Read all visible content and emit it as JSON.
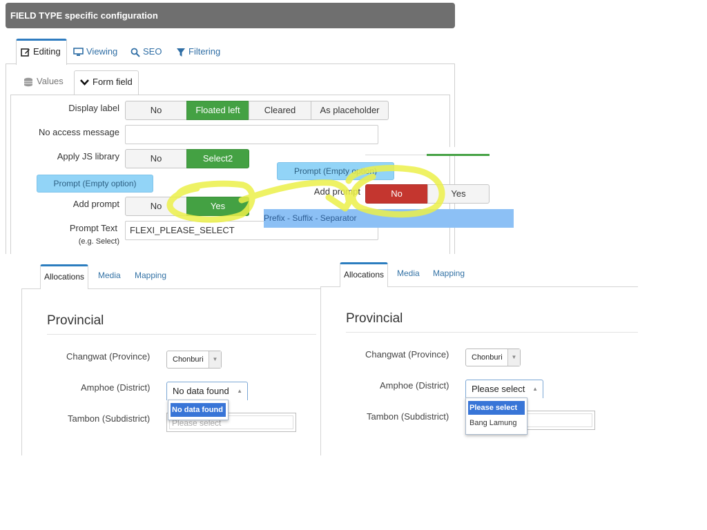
{
  "header": {
    "title": "FIELD TYPE specific configuration"
  },
  "top_tabs": [
    {
      "label": "Editing",
      "icon": "edit-icon",
      "active": true
    },
    {
      "label": "Viewing",
      "icon": "monitor-icon",
      "active": false
    },
    {
      "label": "SEO",
      "icon": "search-icon",
      "active": false
    },
    {
      "label": "Filtering",
      "icon": "filter-icon",
      "active": false
    }
  ],
  "sub_tabs": [
    {
      "label": "Values",
      "icon": "database-icon",
      "active": false
    },
    {
      "label": "Form field",
      "icon": "chevron-down-icon",
      "active": true
    }
  ],
  "form": {
    "display_label": {
      "label": "Display label",
      "options": [
        "No",
        "Floated left",
        "Cleared",
        "As placeholder"
      ],
      "selected": "Floated left"
    },
    "no_access": {
      "label": "No access message",
      "value": ""
    },
    "js_library": {
      "label": "Apply JS library",
      "options": [
        "No",
        "Select2"
      ],
      "selected": "Select2"
    },
    "prompt_pill": "Prompt (Empty option)",
    "add_prompt": {
      "label": "Add prompt",
      "options": [
        "No",
        "Yes"
      ],
      "selected": "Yes"
    },
    "prompt_text": {
      "label": "Prompt Text",
      "hint": "(e.g. Select)",
      "value": "FLEXI_PLEASE_SELECT"
    }
  },
  "overlay": {
    "prompt_pill": "Prompt (Empty option)",
    "add_prompt_label": "Add prompt",
    "add_prompt_options": [
      "No",
      "Yes"
    ],
    "add_prompt_selected": "No",
    "strip_text": "Prefix - Suffix - Separator"
  },
  "highlight_color": "#ecf04a",
  "colors": {
    "green": "#44a143",
    "red": "#c4362f",
    "accent": "#2f7cc0",
    "pill": "#92d4f7"
  },
  "left_panel": {
    "tabs": [
      "Allocations",
      "Media",
      "Mapping"
    ],
    "section_title": "Provincial",
    "province_label": "Changwat (Province)",
    "province_value": "Chonburi",
    "district_label": "Amphoe (District)",
    "district_value": "No data found",
    "district_options": [
      "No data found"
    ],
    "subdistrict_label": "Tambon (Subdistrict)",
    "subdistrict_placeholder": "Please select"
  },
  "right_panel": {
    "tabs": [
      "Allocations",
      "Media",
      "Mapping"
    ],
    "section_title": "Provincial",
    "province_label": "Changwat (Province)",
    "province_value": "Chonburi",
    "district_label": "Amphoe (District)",
    "district_value": "Please select",
    "district_options": [
      "Please select",
      "Bang Lamung"
    ],
    "subdistrict_label": "Tambon (Subdistrict)"
  }
}
